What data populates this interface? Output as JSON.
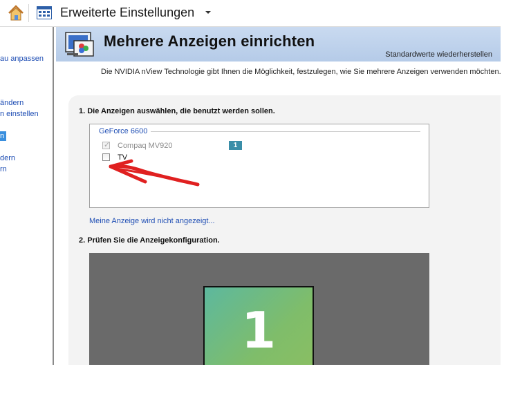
{
  "toolbar": {
    "title": "Erweiterte Einstellungen"
  },
  "sidebar": {
    "items": [
      {
        "label": "au anpassen"
      },
      {
        "label": "ändern"
      },
      {
        "label": "n einstellen"
      },
      {
        "label": "n"
      },
      {
        "label": "dern"
      },
      {
        "label": "rn"
      }
    ]
  },
  "header": {
    "title": "Mehrere Anzeigen einrichten",
    "restore_label": "Standardwerte wiederherstellen"
  },
  "intro_text": "Die NVIDIA nView Technologie gibt Ihnen die Möglichkeit, festzulegen, wie Sie mehrere Anzeigen verwenden möchten.",
  "section1": {
    "heading": "1. Die Anzeigen auswählen, die benutzt werden sollen.",
    "gpu_name": "GeForce 6600",
    "displays": [
      {
        "label": "Compaq MV920",
        "checked": true,
        "disabled": true,
        "badge": "1"
      },
      {
        "label": "TV",
        "checked": false,
        "disabled": false
      }
    ],
    "missing_display_link": "Meine Anzeige wird nicht angezeigt..."
  },
  "section2": {
    "heading": "2. Prüfen Sie die Anzeigekonfiguration.",
    "monitor_number": "1"
  },
  "colors": {
    "header_bg": "#b5cbe8",
    "link": "#1f4eb4",
    "badge": "#3a8ea8",
    "arrow": "#e02020",
    "config_bg": "#6a6a6a"
  }
}
